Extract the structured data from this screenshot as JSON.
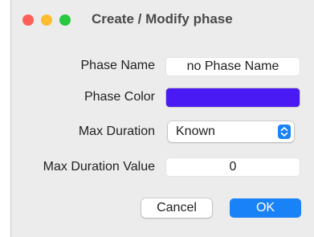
{
  "window": {
    "title": "Create / Modify phase"
  },
  "titlebar": {
    "close_color": "#fe5f57",
    "minimize_color": "#febc2e",
    "maximize_color": "#28c840"
  },
  "form": {
    "phase_name": {
      "label": "Phase Name",
      "value": "no Phase Name"
    },
    "phase_color": {
      "label": "Phase Color",
      "value": "#4a1af4"
    },
    "max_duration": {
      "label": "Max Duration",
      "selected": "Known",
      "stepper_icon": "chevron-up-down-icon"
    },
    "max_duration_value": {
      "label": "Max Duration Value",
      "value": "0"
    }
  },
  "buttons": {
    "cancel_label": "Cancel",
    "ok_label": "OK",
    "accent_color": "#1a82f7"
  }
}
